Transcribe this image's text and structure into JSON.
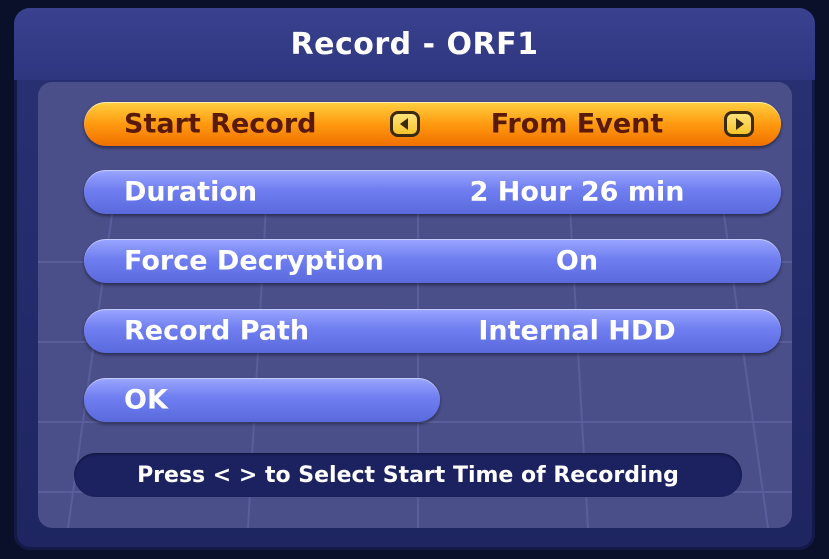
{
  "dialog": {
    "title": "Record - ORF1"
  },
  "rows": [
    {
      "label": "Start Record",
      "value": "From Event",
      "selected": true
    },
    {
      "label": "Duration",
      "value": "2 Hour 26 min",
      "selected": false
    },
    {
      "label": "Force Decryption",
      "value": "On",
      "selected": false
    },
    {
      "label": "Record Path",
      "value": "Internal HDD",
      "selected": false
    },
    {
      "label": "OK",
      "value": "",
      "selected": false
    }
  ],
  "hint": {
    "text": "Press < > to Select Start Time of Recording"
  },
  "icons": {
    "prev": "left-arrow-icon",
    "next": "right-arrow-icon"
  },
  "colors": {
    "selected_row": "#ff9a10",
    "row": "#6f7ef0",
    "dialog": "#2a3275",
    "hint_bar": "#1c2260"
  }
}
